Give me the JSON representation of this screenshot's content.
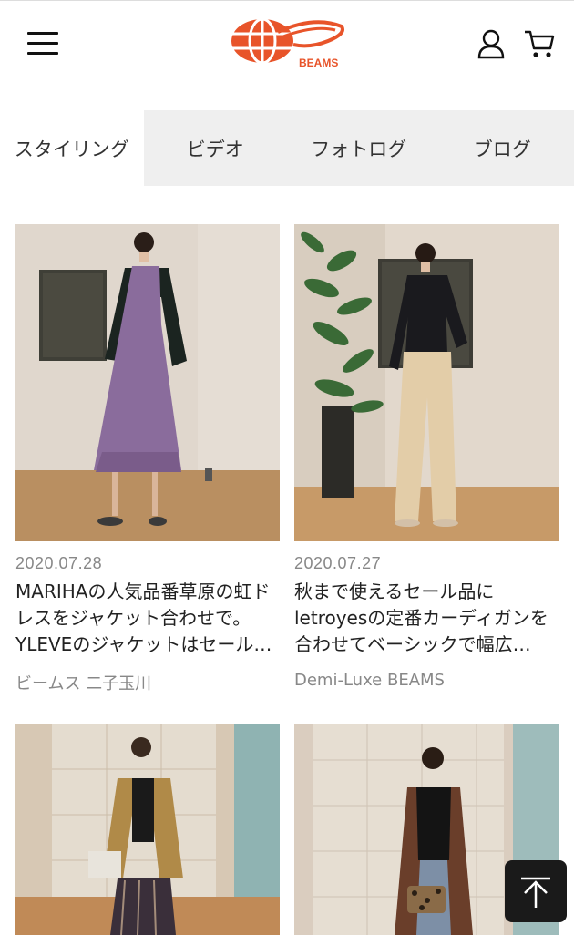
{
  "header": {
    "logo_text": "BEAMS",
    "logo_color": "#e8542a"
  },
  "tabs": [
    {
      "label": "スタイリング",
      "active": true
    },
    {
      "label": "ビデオ",
      "active": false
    },
    {
      "label": "フォトログ",
      "active": false
    },
    {
      "label": "ブログ",
      "active": false
    }
  ],
  "cards": [
    {
      "date": "2020.07.28",
      "title": "MARIHAの人気品番草原の虹ドレスをジャケット合わせで。YLEVEのジャケットはセール…",
      "shop": "ビームス 二子玉川"
    },
    {
      "date": "2020.07.27",
      "title": "秋まで使えるセール品にletroyesの定番カーディガンを合わせてベーシックで幅広…",
      "shop": "Demi-Luxe BEAMS"
    },
    {
      "date": "",
      "title": "",
      "shop": ""
    },
    {
      "date": "",
      "title": "",
      "shop": ""
    }
  ]
}
